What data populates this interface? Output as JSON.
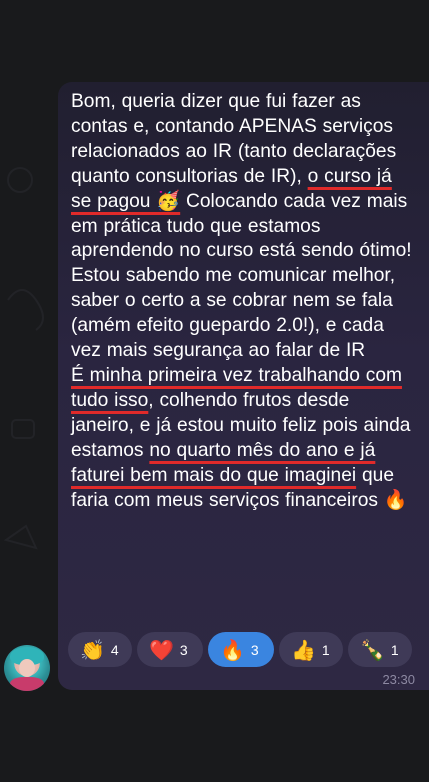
{
  "message": {
    "segments": [
      {
        "t": "Bom, queria dizer que fui fazer as contas e, contando APENAS serviços relacionados ao IR (tanto declarações quanto consultorias de IR), ",
        "hl": false
      },
      {
        "t": "o curso já se pagou 🥳",
        "hl": true
      },
      {
        "t": " Colocando cada vez mais em prática tudo que estamos aprendendo no curso está sendo ótimo! Estou sabendo me comunicar melhor, saber o certo a se cobrar nem se fala (amém efeito guepardo 2.0!), e cada vez mais segurança ao falar de IR",
        "hl": false
      },
      {
        "br": true
      },
      {
        "t": "É minha primeira vez trabalhando com tudo isso",
        "hl": true
      },
      {
        "t": ", colhendo frutos desde janeiro, e já estou muito feliz pois ainda estamos ",
        "hl": false
      },
      {
        "t": "no quarto mês do ano e já faturei bem mais do que imaginei",
        "hl": true
      },
      {
        "t": " que faria com meus serviços financeiros 🔥",
        "hl": false
      }
    ],
    "time": "23:30"
  },
  "reactions": [
    {
      "icon": "👏",
      "icon_name": "clapping-hands-icon",
      "count": "4",
      "selected": false
    },
    {
      "icon": "❤️",
      "icon_name": "red-heart-icon",
      "count": "3",
      "selected": false
    },
    {
      "icon": "🔥",
      "icon_name": "fire-icon",
      "count": "3",
      "selected": true
    },
    {
      "icon": "👍",
      "icon_name": "thumbs-up-icon",
      "count": "1",
      "selected": false
    },
    {
      "icon": "🍾",
      "icon_name": "champagne-icon",
      "count": "1",
      "selected": false
    }
  ],
  "colors": {
    "background": "#191a1c",
    "bubble": "#2a2540",
    "underline": "#e02a2a",
    "selected_reaction": "#3a85e0",
    "reaction": "#3f3a57",
    "timestamp": "#8d89a2"
  },
  "avatar": {
    "icon_name": "user-avatar"
  }
}
